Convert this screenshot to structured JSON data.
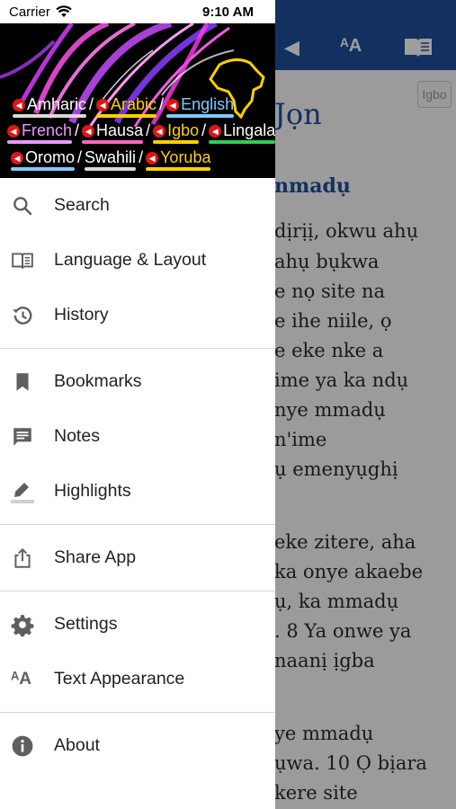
{
  "status_bar": {
    "carrier": "Carrier",
    "time": "9:10 AM"
  },
  "banner": {
    "rows": [
      [
        {
          "label": "Amharic",
          "color": "#ffffff",
          "underline": "#d9d9d9"
        },
        {
          "label": "Arabic",
          "color": "#ffd000",
          "underline": "#ffd000"
        },
        {
          "label": "English",
          "color": "#7ecbff",
          "underline": "#7ecbff"
        }
      ],
      [
        {
          "label": "French",
          "color": "#e899ff",
          "underline": "#e899ff"
        },
        {
          "label": "Hausa",
          "color": "#ffffff",
          "underline": "#ff66bb"
        },
        {
          "label": "Igbo",
          "color": "#ffd000",
          "underline": "#ffd000"
        },
        {
          "label": "Lingala",
          "color": "#ffffff",
          "underline": "#33cc55"
        }
      ],
      [
        {
          "label": "Oromo",
          "color": "#ffffff",
          "underline": "#7ecbff"
        },
        {
          "label": "Swahili",
          "color": "#ffffff",
          "underline": "#d9d9d9"
        },
        {
          "label": "Yoruba",
          "color": "#ffd000",
          "underline": "#ffd000"
        }
      ]
    ],
    "separator": "/",
    "speaker_glyph": "◀",
    "africa_color": "#ffd000"
  },
  "menu": {
    "group1": [
      {
        "label": "Search",
        "icon": "search-icon"
      },
      {
        "label": "Language & Layout",
        "icon": "book-open-icon"
      },
      {
        "label": "History",
        "icon": "history-icon"
      }
    ],
    "group2": [
      {
        "label": "Bookmarks",
        "icon": "bookmark-icon"
      },
      {
        "label": "Notes",
        "icon": "notes-icon"
      },
      {
        "label": "Highlights",
        "icon": "highlighter-icon"
      }
    ],
    "group3": [
      {
        "label": "Share App",
        "icon": "share-icon"
      }
    ],
    "group4": [
      {
        "label": "Settings",
        "icon": "gear-icon"
      },
      {
        "label": "Text Appearance",
        "icon": "text-size-icon"
      }
    ],
    "group5": [
      {
        "label": "About",
        "icon": "info-icon"
      }
    ]
  },
  "background_reader": {
    "language_chip": "Igbo",
    "chapter_title": "Jọn",
    "section_heading": "nmadụ",
    "lines": [
      "dịrịị, okwu ahụ",
      "ahụ bụkwa",
      "e nọ site na",
      "e ihe niile, ọ",
      "e eke nke a",
      "ime ya ka ndụ",
      "nye mmadụ",
      "n'ime",
      "ụ emenyụghị",
      "eke zitere, aha",
      "ka onye akaebe",
      "ụ, ka mmadụ",
      ". 8 Ya onwe ya",
      "naanị ịgba",
      "ye mmadụ",
      "ụwa. 10 Ọ bịara",
      "kere site"
    ]
  }
}
